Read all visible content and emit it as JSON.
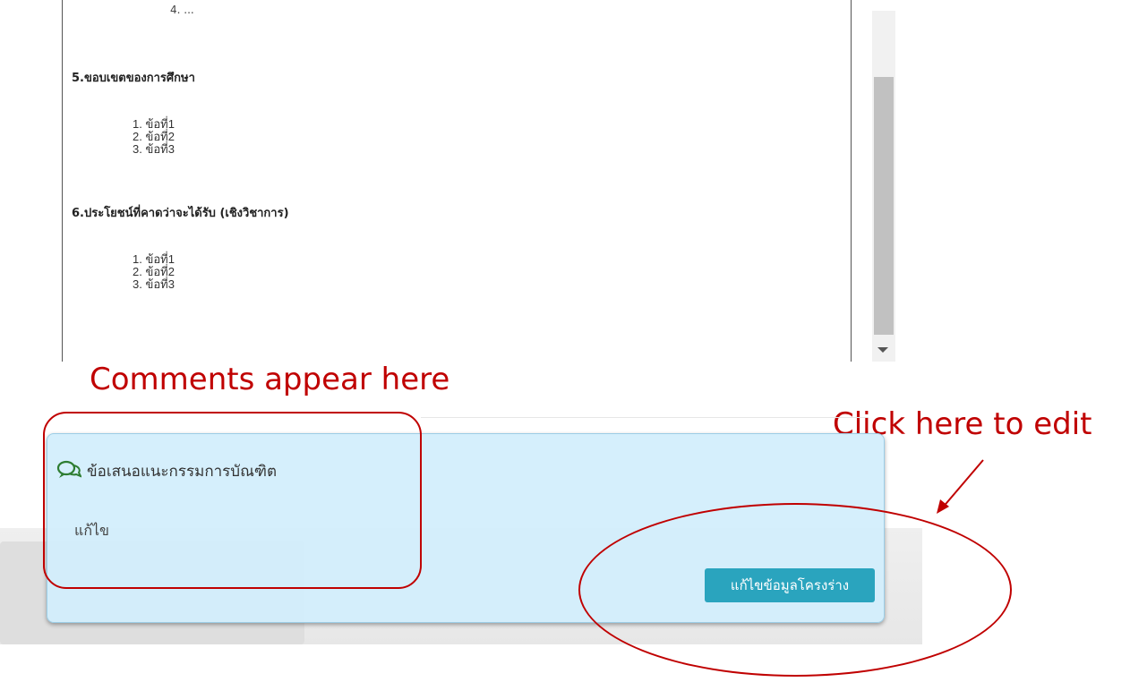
{
  "document": {
    "cut_line": "4. ...",
    "sections": [
      {
        "heading": "5.ขอบเขตของการศึกษา",
        "items": [
          "1. ข้อที่1",
          "2. ข้อที่2",
          "3. ข้อที่3"
        ]
      },
      {
        "heading": "6.ประโยชน์ที่คาดว่าจะได้รับ (เชิงวิชาการ)",
        "items": [
          "1. ข้อที่1",
          "2. ข้อที่2",
          "3. ข้อที่3"
        ]
      }
    ]
  },
  "annotations": {
    "comments_label": "Comments appear here",
    "edit_label": "Click here to edit",
    "color": "#c00000"
  },
  "comments_panel": {
    "title": "ข้อเสนอแนะกรรมการบัณฑิต",
    "comment_text": "แก้ไข",
    "edit_button_label": "แก้ไขข้อมูลโครงร่าง",
    "icon": "chat-bubbles-icon",
    "accent_color": "#2aa4be"
  }
}
